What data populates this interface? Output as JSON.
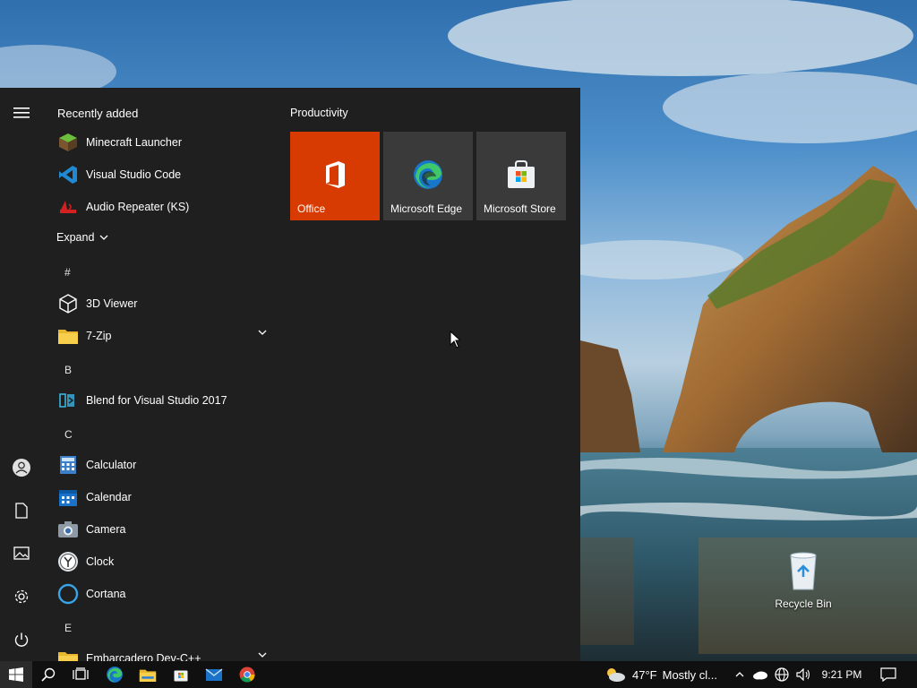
{
  "desktop": {
    "recycle_bin_label": "Recycle Bin"
  },
  "start_menu": {
    "recently_added_title": "Recently added",
    "recent_apps": [
      {
        "label": "Minecraft Launcher",
        "icon": "minecraft-icon"
      },
      {
        "label": "Visual Studio Code",
        "icon": "vscode-icon"
      },
      {
        "label": "Audio Repeater (KS)",
        "icon": "audio-repeater-icon"
      }
    ],
    "expand_label": "Expand",
    "letters": {
      "hash": "#",
      "b": "B",
      "c": "C",
      "e": "E"
    },
    "apps": [
      {
        "label": "3D Viewer",
        "icon": "cube-icon"
      },
      {
        "label": "7-Zip",
        "icon": "folder-icon"
      },
      {
        "label": "Blend for Visual Studio 2017",
        "icon": "blend-icon"
      },
      {
        "label": "Calculator",
        "icon": "calculator-icon"
      },
      {
        "label": "Calendar",
        "icon": "calendar-icon"
      },
      {
        "label": "Camera",
        "icon": "camera-icon"
      },
      {
        "label": "Clock",
        "icon": "clock-icon"
      },
      {
        "label": "Cortana",
        "icon": "cortana-icon"
      },
      {
        "label": "Embarcadero Dev-C++",
        "icon": "folder-icon"
      }
    ],
    "tile_group_title": "Productivity",
    "tiles": [
      {
        "label": "Office",
        "color": "#d83b01",
        "icon": "office-icon"
      },
      {
        "label": "Microsoft Edge",
        "color": "#3a3a3a",
        "icon": "edge-icon"
      },
      {
        "label": "Microsoft Store",
        "color": "#3a3a3a",
        "icon": "store-icon"
      }
    ]
  },
  "taskbar": {
    "weather_temp": "47°F",
    "weather_text": "Mostly cl...",
    "clock": "9:21 PM"
  },
  "colors": {
    "start_bg": "#1f1f1f",
    "taskbar_bg": "#101010",
    "office_tile": "#d83b01",
    "tile_bg": "#3a3a3a"
  }
}
